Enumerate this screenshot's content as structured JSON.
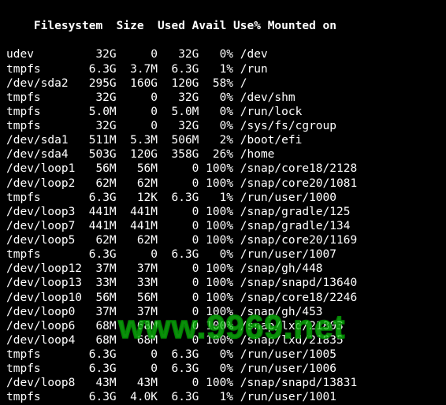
{
  "headers": {
    "filesystem": "Filesystem",
    "size": "Size",
    "used": "Used",
    "avail": "Avail",
    "usepct": "Use%",
    "mounted_on": "Mounted on"
  },
  "rows": [
    {
      "filesystem": "udev",
      "size": "32G",
      "used": "0",
      "avail": "32G",
      "usepct": "0%",
      "mounted_on": "/dev"
    },
    {
      "filesystem": "tmpfs",
      "size": "6.3G",
      "used": "3.7M",
      "avail": "6.3G",
      "usepct": "1%",
      "mounted_on": "/run"
    },
    {
      "filesystem": "/dev/sda2",
      "size": "295G",
      "used": "160G",
      "avail": "120G",
      "usepct": "58%",
      "mounted_on": "/"
    },
    {
      "filesystem": "tmpfs",
      "size": "32G",
      "used": "0",
      "avail": "32G",
      "usepct": "0%",
      "mounted_on": "/dev/shm"
    },
    {
      "filesystem": "tmpfs",
      "size": "5.0M",
      "used": "0",
      "avail": "5.0M",
      "usepct": "0%",
      "mounted_on": "/run/lock"
    },
    {
      "filesystem": "tmpfs",
      "size": "32G",
      "used": "0",
      "avail": "32G",
      "usepct": "0%",
      "mounted_on": "/sys/fs/cgroup"
    },
    {
      "filesystem": "/dev/sda1",
      "size": "511M",
      "used": "5.3M",
      "avail": "506M",
      "usepct": "2%",
      "mounted_on": "/boot/efi"
    },
    {
      "filesystem": "/dev/sda4",
      "size": "503G",
      "used": "120G",
      "avail": "358G",
      "usepct": "26%",
      "mounted_on": "/home"
    },
    {
      "filesystem": "/dev/loop1",
      "size": "56M",
      "used": "56M",
      "avail": "0",
      "usepct": "100%",
      "mounted_on": "/snap/core18/2128"
    },
    {
      "filesystem": "/dev/loop2",
      "size": "62M",
      "used": "62M",
      "avail": "0",
      "usepct": "100%",
      "mounted_on": "/snap/core20/1081"
    },
    {
      "filesystem": "tmpfs",
      "size": "6.3G",
      "used": "12K",
      "avail": "6.3G",
      "usepct": "1%",
      "mounted_on": "/run/user/1000"
    },
    {
      "filesystem": "/dev/loop3",
      "size": "441M",
      "used": "441M",
      "avail": "0",
      "usepct": "100%",
      "mounted_on": "/snap/gradle/125"
    },
    {
      "filesystem": "/dev/loop7",
      "size": "441M",
      "used": "441M",
      "avail": "0",
      "usepct": "100%",
      "mounted_on": "/snap/gradle/134"
    },
    {
      "filesystem": "/dev/loop5",
      "size": "62M",
      "used": "62M",
      "avail": "0",
      "usepct": "100%",
      "mounted_on": "/snap/core20/1169"
    },
    {
      "filesystem": "tmpfs",
      "size": "6.3G",
      "used": "0",
      "avail": "6.3G",
      "usepct": "0%",
      "mounted_on": "/run/user/1007"
    },
    {
      "filesystem": "/dev/loop12",
      "size": "37M",
      "used": "37M",
      "avail": "0",
      "usepct": "100%",
      "mounted_on": "/snap/gh/448"
    },
    {
      "filesystem": "/dev/loop13",
      "size": "33M",
      "used": "33M",
      "avail": "0",
      "usepct": "100%",
      "mounted_on": "/snap/snapd/13640"
    },
    {
      "filesystem": "/dev/loop10",
      "size": "56M",
      "used": "56M",
      "avail": "0",
      "usepct": "100%",
      "mounted_on": "/snap/core18/2246"
    },
    {
      "filesystem": "/dev/loop0",
      "size": "37M",
      "used": "37M",
      "avail": "0",
      "usepct": "100%",
      "mounted_on": "/snap/gh/453"
    },
    {
      "filesystem": "/dev/loop6",
      "size": "68M",
      "used": "68M",
      "avail": "0",
      "usepct": "100%",
      "mounted_on": "/snap/lxd/21803"
    },
    {
      "filesystem": "/dev/loop4",
      "size": "68M",
      "used": "68M",
      "avail": "0",
      "usepct": "100%",
      "mounted_on": "/snap/lxd/21835"
    },
    {
      "filesystem": "tmpfs",
      "size": "6.3G",
      "used": "0",
      "avail": "6.3G",
      "usepct": "0%",
      "mounted_on": "/run/user/1005"
    },
    {
      "filesystem": "tmpfs",
      "size": "6.3G",
      "used": "0",
      "avail": "6.3G",
      "usepct": "0%",
      "mounted_on": "/run/user/1006"
    },
    {
      "filesystem": "/dev/loop8",
      "size": "43M",
      "used": "43M",
      "avail": "0",
      "usepct": "100%",
      "mounted_on": "/snap/snapd/13831"
    },
    {
      "filesystem": "tmpfs",
      "size": "6.3G",
      "used": "4.0K",
      "avail": "6.3G",
      "usepct": "1%",
      "mounted_on": "/run/user/1001"
    }
  ],
  "watermark": "www.9969.net"
}
